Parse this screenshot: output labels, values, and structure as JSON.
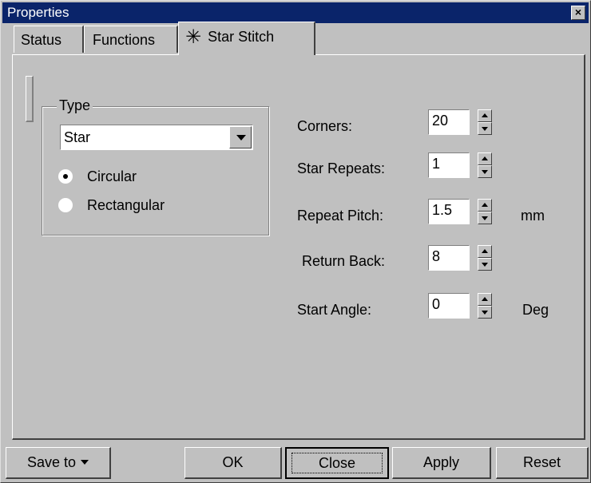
{
  "window": {
    "title": "Properties",
    "close_glyph": "×"
  },
  "tabs": [
    {
      "label": "Status",
      "active": false
    },
    {
      "label": "Functions",
      "active": false
    },
    {
      "label": "Star Stitch",
      "active": true,
      "icon": "star-stitch-icon"
    }
  ],
  "type_group": {
    "legend": "Type",
    "combo_value": "Star",
    "radios": [
      {
        "label": "Circular",
        "checked": true
      },
      {
        "label": "Rectangular",
        "checked": false
      }
    ]
  },
  "fields": [
    {
      "label": "Corners:",
      "value": "20",
      "unit": ""
    },
    {
      "label": "Star Repeats:",
      "value": "1",
      "unit": ""
    },
    {
      "label": "Repeat Pitch:",
      "value": "1.5",
      "unit": "mm"
    },
    {
      "label": "Return Back:",
      "value": "8",
      "unit": ""
    },
    {
      "label": "Start Angle:",
      "value": "0",
      "unit": "Deg"
    }
  ],
  "buttons": {
    "save_to": "Save to",
    "ok": "OK",
    "close": "Close",
    "apply": "Apply",
    "reset": "Reset"
  },
  "colors": {
    "titlebar": "#0a246a",
    "face": "#c0c0c0"
  }
}
